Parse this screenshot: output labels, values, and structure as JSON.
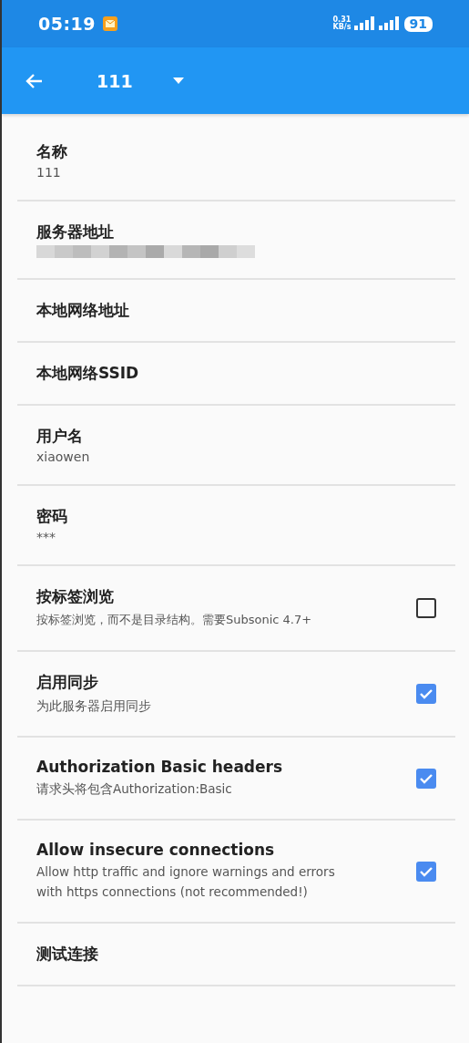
{
  "status_bar": {
    "time": "05:19",
    "net_speed_value": "0.31",
    "net_speed_unit": "KB/s",
    "battery": "91"
  },
  "app_bar": {
    "title": "111"
  },
  "settings": [
    {
      "kind": "text",
      "title": "名称",
      "value": "111"
    },
    {
      "kind": "redacted",
      "title": "服务器地址"
    },
    {
      "kind": "text",
      "title": "本地网络地址"
    },
    {
      "kind": "text",
      "title": "本地网络SSID"
    },
    {
      "kind": "text",
      "title": "用户名",
      "value": "xiaowen"
    },
    {
      "kind": "text",
      "title": "密码",
      "value": "***"
    },
    {
      "kind": "checkbox",
      "title": "按标签浏览",
      "summary": "按标签浏览，而不是目录结构。需要Subsonic 4.7+",
      "checked": false
    },
    {
      "kind": "checkbox",
      "title": "启用同步",
      "summary": "为此服务器启用同步",
      "checked": true
    },
    {
      "kind": "checkbox",
      "title": "Authorization Basic headers",
      "summary": "请求头将包含Authorization:Basic",
      "checked": true
    },
    {
      "kind": "checkbox",
      "title": "Allow insecure connections",
      "summary": "Allow http traffic and ignore warnings and errors with https connections (not recommended!)",
      "checked": true
    },
    {
      "kind": "text",
      "title": "测试连接"
    }
  ]
}
